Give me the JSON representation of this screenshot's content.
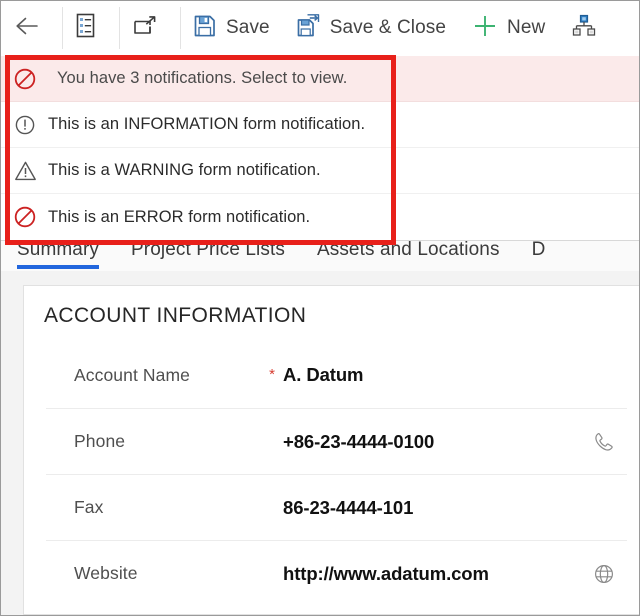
{
  "commandbar": {
    "items": [
      {
        "name": "back-button",
        "icon": "back-arrow-icon",
        "label": ""
      },
      {
        "name": "form-selector",
        "icon": "form-list-icon",
        "label": ""
      },
      {
        "name": "popout-button",
        "icon": "popout-icon",
        "label": ""
      },
      {
        "name": "save-button",
        "icon": "save-icon",
        "label": "Save"
      },
      {
        "name": "save-close-button",
        "icon": "save-close-icon",
        "label": "Save & Close"
      },
      {
        "name": "new-button",
        "icon": "plus-icon",
        "label": "New"
      },
      {
        "name": "hierarchy-button",
        "icon": "hierarchy-icon",
        "label": ""
      }
    ]
  },
  "notifications": {
    "summary": {
      "icon": "error-circle-slash-icon",
      "count": "3",
      "text": "You have 3 notifications. Select to view."
    },
    "items": [
      {
        "level": "information",
        "icon": "info-circle-icon",
        "text": "This is an INFORMATION form notification."
      },
      {
        "level": "warning",
        "icon": "warning-triangle-icon",
        "text": "This is a WARNING form notification."
      },
      {
        "level": "error",
        "icon": "error-circle-slash-icon",
        "text": "This is an ERROR form notification."
      }
    ]
  },
  "tabs": [
    {
      "label": "Summary",
      "active": true
    },
    {
      "label": "Project Price Lists",
      "active": false
    },
    {
      "label": "Assets and Locations",
      "active": false
    },
    {
      "label": "D",
      "active": false
    }
  ],
  "form": {
    "section_title": "ACCOUNT INFORMATION",
    "fields": [
      {
        "label": "Account Name",
        "required": "*",
        "value": "A. Datum",
        "action_icon": ""
      },
      {
        "label": "Phone",
        "required": "",
        "value": "+86-23-4444-0100",
        "action_icon": "phone-icon"
      },
      {
        "label": "Fax",
        "required": "",
        "value": "86-23-4444-101",
        "action_icon": ""
      },
      {
        "label": "Website",
        "required": "",
        "value": "http://www.adatum.com",
        "action_icon": "globe-icon"
      }
    ]
  },
  "colors": {
    "accent_blue": "#2266dd",
    "error_red": "#e8201a",
    "notification_bg": "#fbeaea",
    "new_green": "#3cb371",
    "save_blue": "#4a89c8"
  }
}
